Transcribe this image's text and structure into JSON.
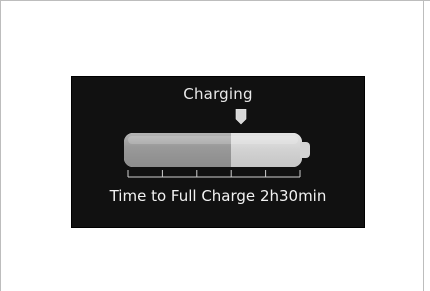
{
  "display": {
    "status": "Charging",
    "time_to_full_label": "Time to Full Charge",
    "time_to_full_value": "2h30min",
    "charge_fraction": 0.6,
    "tick_count": 5
  },
  "icons": {
    "pointer": "charge-indicator-pointer-icon",
    "battery": "battery-icon"
  },
  "colors": {
    "screen_background": "#111111",
    "text": "#f2f2f2",
    "battery_charged": "#9a9a9a",
    "battery_empty": "#d2d2d2"
  }
}
